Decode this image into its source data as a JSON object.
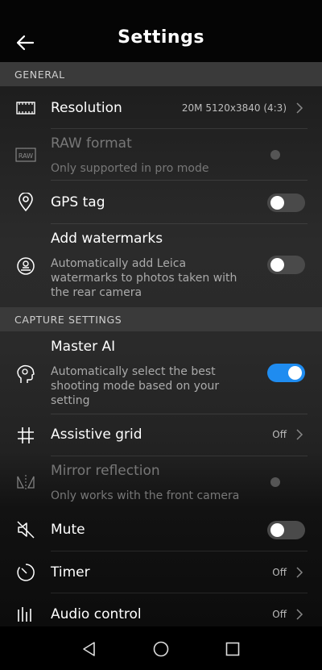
{
  "header": {
    "title": "Settings"
  },
  "sections": {
    "general": "GENERAL",
    "capture": "CAPTURE SETTINGS"
  },
  "rows": {
    "resolution": {
      "label": "Resolution",
      "value": "20M 5120x3840 (4:3)",
      "icon": "resolution-icon"
    },
    "raw": {
      "label": "RAW format",
      "desc": "Only supported in pro mode",
      "icon": "raw-icon",
      "toggle": false,
      "enabled": false
    },
    "gps": {
      "label": "GPS tag",
      "icon": "location-pin-icon",
      "toggle": false
    },
    "watermarks": {
      "label": "Add watermarks",
      "desc": "Automatically add Leica watermarks to photos taken with the rear camera",
      "icon": "watermark-icon",
      "toggle": false
    },
    "master_ai": {
      "label": "Master AI",
      "desc": "Automatically select the best shooting mode based on your setting",
      "icon": "ai-head-icon",
      "toggle": true
    },
    "grid": {
      "label": "Assistive grid",
      "value": "Off",
      "icon": "grid-icon"
    },
    "mirror": {
      "label": "Mirror reflection",
      "desc": "Only works with the front camera",
      "icon": "mirror-icon",
      "toggle": false,
      "enabled": false
    },
    "mute": {
      "label": "Mute",
      "icon": "speaker-mute-icon",
      "toggle": false
    },
    "timer": {
      "label": "Timer",
      "value": "Off",
      "icon": "timer-icon"
    },
    "audio": {
      "label": "Audio control",
      "value": "Off",
      "icon": "audio-control-icon"
    }
  },
  "colors": {
    "accent": "#1f8cf0",
    "section_bg": "#3a3a3a",
    "background": "#2a2a2a"
  }
}
